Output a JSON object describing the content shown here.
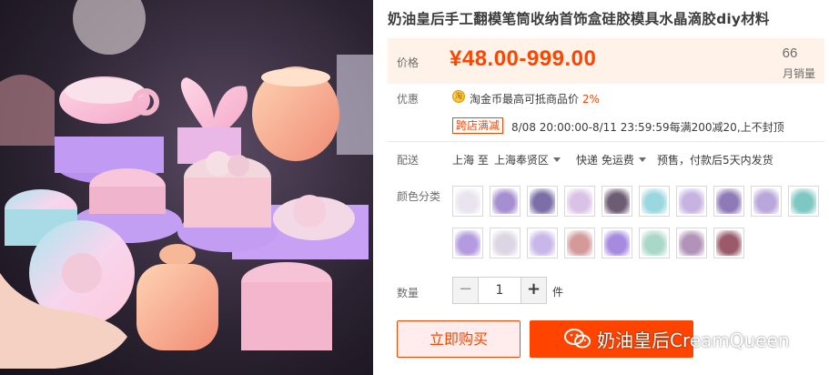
{
  "product": {
    "title": "奶油皇后手工翻模笔筒收纳首饰盒硅胶模具水晶滴胶diy材料"
  },
  "price": {
    "label": "价格",
    "value": "¥48.00-999.00",
    "sales_count": "66",
    "sales_label": "月销量",
    "accent_color": "#ff4400"
  },
  "promotion": {
    "label": "优惠",
    "coin_icon": "coin-icon",
    "coin_text": "淘金币最高可抵商品价 ",
    "coin_percent": "2%",
    "badge": "跨店满减",
    "detail": "8/08 20:00:00-8/11 23:59:59每满200减20,上不封顶"
  },
  "shipping": {
    "label": "配送",
    "from": "上海 至",
    "to": "上海奉贤区",
    "method": "快递 免运费",
    "note": "预售，付款后5天内发货"
  },
  "colors": {
    "label": "颜色分类",
    "swatches": [
      {
        "icon": "swatch-grid-icon",
        "color": "#e9e4ee"
      },
      {
        "icon": "swatch-purple-mold-icon",
        "color": "#a58fd0"
      },
      {
        "icon": "swatch-cup-icon",
        "color": "#7c6fa8"
      },
      {
        "icon": "swatch-box-icon",
        "color": "#d9c2e6"
      },
      {
        "icon": "swatch-dark-box-icon",
        "color": "#6c5d74"
      },
      {
        "icon": "swatch-aqua-icon",
        "color": "#9ad7df"
      },
      {
        "icon": "swatch-flower-icon",
        "color": "#c6b3e2"
      },
      {
        "icon": "swatch-jar-icon",
        "color": "#8f7ab8"
      },
      {
        "icon": "swatch-round-icon",
        "color": "#b9a6db"
      },
      {
        "icon": "swatch-teal-icon",
        "color": "#7fc7c2"
      },
      {
        "icon": "swatch-lavender-icon",
        "color": "#b49adf"
      },
      {
        "icon": "swatch-clear-icon",
        "color": "#dcd6e4"
      },
      {
        "icon": "swatch-lilac-icon",
        "color": "#c9b7ea"
      },
      {
        "icon": "swatch-rose-icon",
        "color": "#d49a9a"
      },
      {
        "icon": "swatch-violet-icon",
        "color": "#a68ae0"
      },
      {
        "icon": "swatch-mint-icon",
        "color": "#a9d8c8"
      },
      {
        "icon": "swatch-mauve-icon",
        "color": "#b292b9"
      },
      {
        "icon": "swatch-berry-icon",
        "color": "#9a5a6a"
      }
    ]
  },
  "quantity": {
    "label": "数量",
    "minus": "−",
    "value": "1",
    "plus": "+",
    "unit": "件"
  },
  "actions": {
    "buy_now": "立即购买"
  },
  "watermark": {
    "icon": "wechat-icon",
    "text": "奶油皇后CreamQueen"
  }
}
